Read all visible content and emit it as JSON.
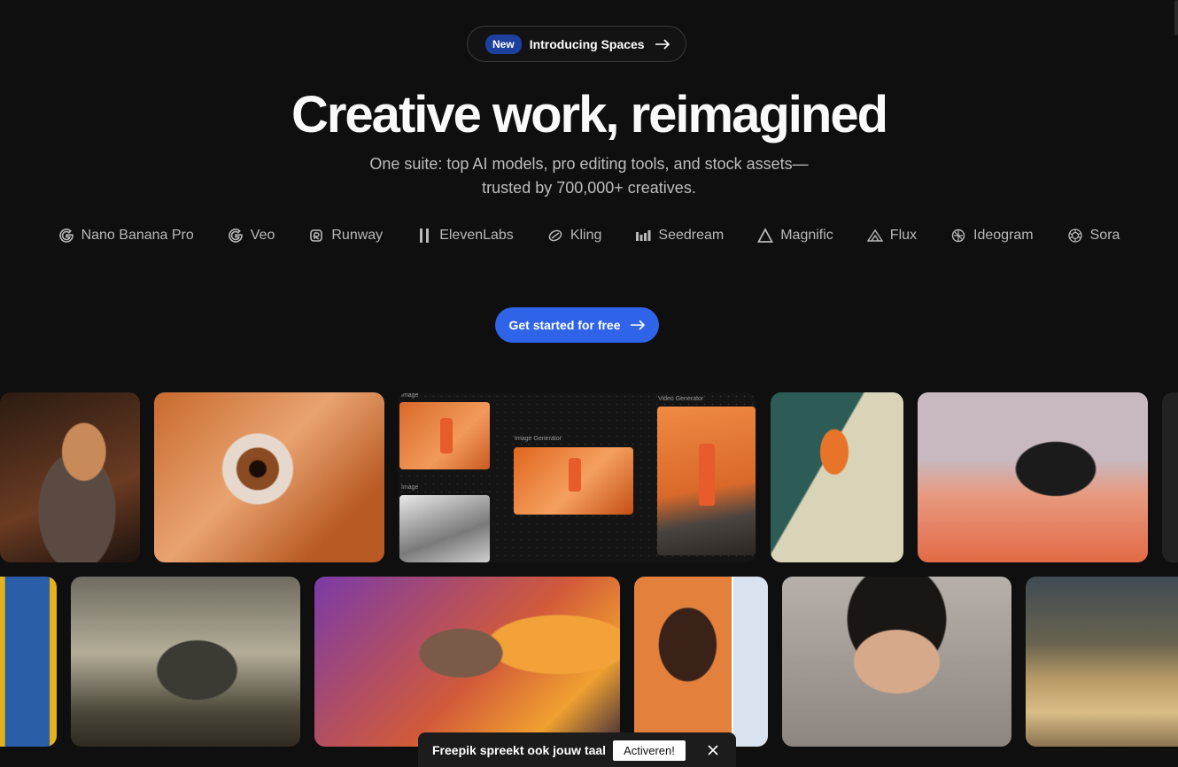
{
  "announcement": {
    "badge": "New",
    "text": "Introducing Spaces"
  },
  "hero": {
    "title": "Creative work, reimagined",
    "subtitle_line1": "One suite: top AI models, pro editing tools, and stock assets—",
    "subtitle_line2": "trusted by 700,000+ creatives."
  },
  "models": [
    {
      "label": "Nano Banana Pro",
      "icon": "google-icon"
    },
    {
      "label": "Veo",
      "icon": "google-icon"
    },
    {
      "label": "Runway",
      "icon": "runway-icon"
    },
    {
      "label": "ElevenLabs",
      "icon": "elevenlabs-icon"
    },
    {
      "label": "Kling",
      "icon": "kling-icon"
    },
    {
      "label": "Seedream",
      "icon": "seedream-icon"
    },
    {
      "label": "Magnific",
      "icon": "magnific-icon"
    },
    {
      "label": "Flux",
      "icon": "flux-icon"
    },
    {
      "label": "Ideogram",
      "icon": "ideogram-icon"
    },
    {
      "label": "Sora",
      "icon": "openai-icon"
    }
  ],
  "cta": {
    "label": "Get started for free"
  },
  "canvas_nodes": {
    "image1": "Image",
    "image2": "Image",
    "image_generator": "Image Generator",
    "video_generator": "Video Generator"
  },
  "language_bar": {
    "text": "Freepik spreekt ook jouw taal",
    "button": "Activeren!"
  },
  "colors": {
    "background": "#0f0f0f",
    "accent": "#2f63e8",
    "badge": "#1d3f9e"
  }
}
